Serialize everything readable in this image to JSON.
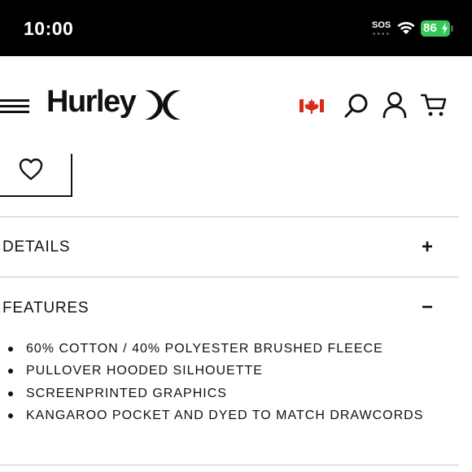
{
  "status_bar": {
    "time": "10:00",
    "sos": "SOS",
    "battery": "86",
    "battery_color": "#34c759"
  },
  "header": {
    "brand": "Hurley",
    "icons": [
      "menu-icon",
      "brand-mark-icon",
      "canada-flag-icon",
      "search-icon",
      "account-icon",
      "cart-icon"
    ]
  },
  "wishlist": {
    "icon": "heart-icon"
  },
  "accordion": {
    "details": {
      "title": "DETAILS",
      "toggle": "+"
    },
    "features": {
      "title": "FEATURES",
      "toggle": "−",
      "items": [
        "60% COTTON / 40% POLYESTER BRUSHED FLEECE",
        "PULLOVER HOODED SILHOUETTE",
        "SCREENPRINTED GRAPHICS",
        "KANGAROO POCKET AND DYED TO MATCH DRAWCORDS"
      ]
    }
  },
  "colors": {
    "accent_red": "#d52b1e",
    "divider": "#c8c8c8"
  }
}
